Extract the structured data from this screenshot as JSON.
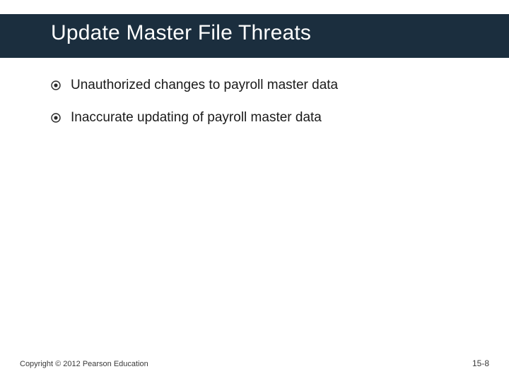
{
  "header": {
    "title": "Update Master File Threats"
  },
  "bullets": [
    {
      "text": "Unauthorized changes to payroll master data"
    },
    {
      "text": "Inaccurate updating of payroll master data"
    }
  ],
  "footer": {
    "copyright": "Copyright © 2012 Pearson Education",
    "page": "15-8"
  },
  "colors": {
    "band": "#1b2e3e",
    "text": "#1a1a1a"
  }
}
